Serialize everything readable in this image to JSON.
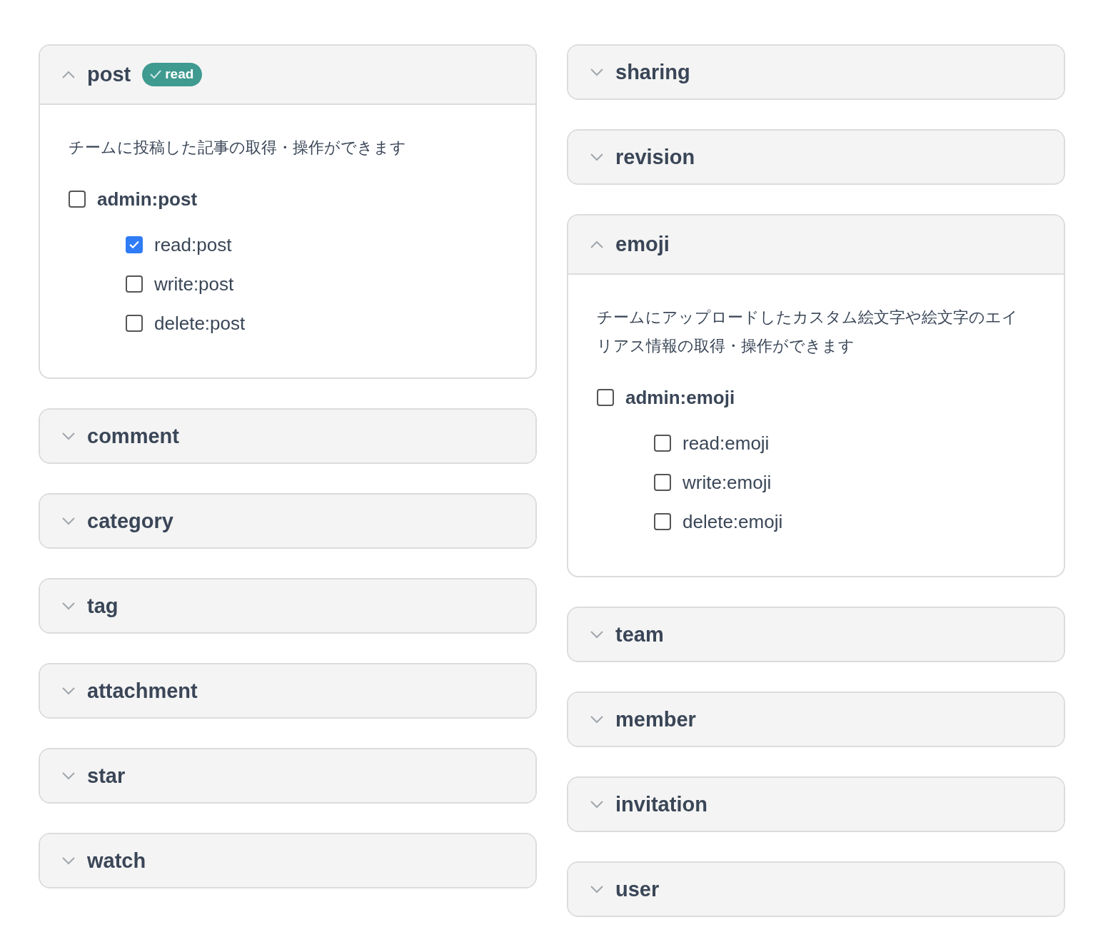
{
  "columns": [
    {
      "sections": [
        {
          "title": "post",
          "expanded": true,
          "badge": {
            "label": "read"
          },
          "description": "チームに投稿した記事の取得・操作ができます",
          "admin": {
            "label": "admin:post",
            "checked": false
          },
          "scopes": [
            {
              "label": "read:post",
              "checked": true
            },
            {
              "label": "write:post",
              "checked": false
            },
            {
              "label": "delete:post",
              "checked": false
            }
          ]
        },
        {
          "title": "comment",
          "expanded": false
        },
        {
          "title": "category",
          "expanded": false
        },
        {
          "title": "tag",
          "expanded": false
        },
        {
          "title": "attachment",
          "expanded": false
        },
        {
          "title": "star",
          "expanded": false
        },
        {
          "title": "watch",
          "expanded": false
        }
      ]
    },
    {
      "sections": [
        {
          "title": "sharing",
          "expanded": false
        },
        {
          "title": "revision",
          "expanded": false
        },
        {
          "title": "emoji",
          "expanded": true,
          "description": "チームにアップロードしたカスタム絵文字や絵文字のエイリアス情報の取得・操作ができます",
          "admin": {
            "label": "admin:emoji",
            "checked": false
          },
          "scopes": [
            {
              "label": "read:emoji",
              "checked": false
            },
            {
              "label": "write:emoji",
              "checked": false
            },
            {
              "label": "delete:emoji",
              "checked": false
            }
          ]
        },
        {
          "title": "team",
          "expanded": false
        },
        {
          "title": "member",
          "expanded": false
        },
        {
          "title": "invitation",
          "expanded": false
        },
        {
          "title": "user",
          "expanded": false
        }
      ]
    }
  ]
}
